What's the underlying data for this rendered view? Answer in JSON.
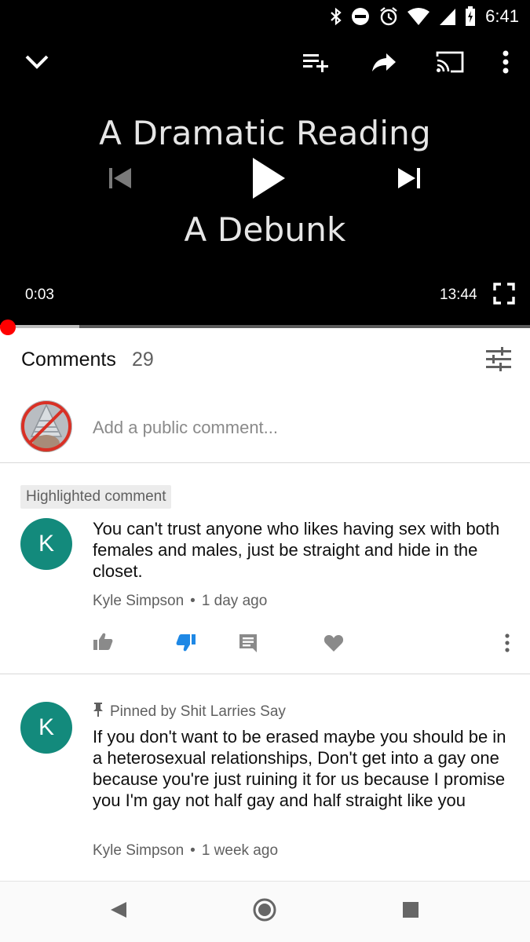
{
  "status_bar": {
    "time": "6:41"
  },
  "player": {
    "slide_line1": "A Dramatic Reading",
    "slide_line2": "A Debunk",
    "current_time": "0:03",
    "duration": "13:44",
    "progress_fraction": 0.004,
    "buffered_fraction": 0.15,
    "accent_color": "#ff0000"
  },
  "comments": {
    "title": "Comments",
    "count": "29",
    "add_placeholder": "Add a public comment...",
    "highlighted_label": "Highlighted comment",
    "items": [
      {
        "avatar_letter": "K",
        "text": "You can't trust anyone who likes having sex with both females and males, just be straight and hide in the closet.",
        "author": "Kyle Simpson",
        "age": "1 day ago",
        "dislike_active": true
      },
      {
        "avatar_letter": "K",
        "pinned_by": "Pinned by Shit Larries Say",
        "text": "If you don't want to be erased maybe you should be in a heterosexual relationships, Don't get into a gay one because you're just ruining it for us because I promise you I'm gay not half gay and half straight like you",
        "author": "Kyle Simpson",
        "age": "1 week ago"
      }
    ]
  },
  "colors": {
    "avatar_teal": "#138a7c",
    "dislike_blue": "#1e88e5"
  },
  "icons": {
    "collapse": "chevron-down-icon",
    "add_to_playlist": "playlist-add-icon",
    "share": "share-icon",
    "cast": "cast-icon",
    "more": "more-vert-icon",
    "previous": "skip-previous-icon",
    "play": "play-icon",
    "next": "skip-next-icon",
    "fullscreen": "fullscreen-icon",
    "sort": "sort-filter-icon",
    "like": "thumbs-up-icon",
    "dislike": "thumbs-down-icon",
    "reply": "reply-icon",
    "heart": "heart-icon",
    "pin": "pin-icon"
  }
}
